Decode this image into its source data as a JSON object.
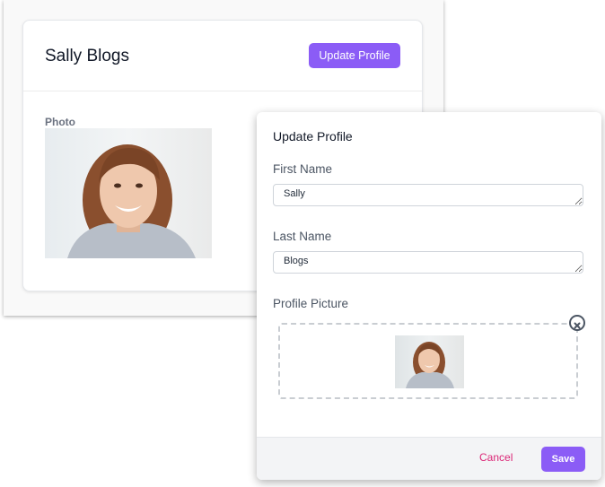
{
  "profile": {
    "name": "Sally Blogs",
    "update_button_label": "Update Profile",
    "photo_label": "Photo"
  },
  "modal": {
    "title": "Update Profile",
    "first_name_label": "First Name",
    "first_name_value": "Sally",
    "last_name_label": "Last Name",
    "last_name_value": "Blogs",
    "picture_label": "Profile Picture",
    "cancel_label": "Cancel",
    "save_label": "Save"
  },
  "icons": {
    "remove": "close-circle-icon"
  },
  "colors": {
    "accent": "#8b5cf6",
    "cancel": "#db2777"
  }
}
